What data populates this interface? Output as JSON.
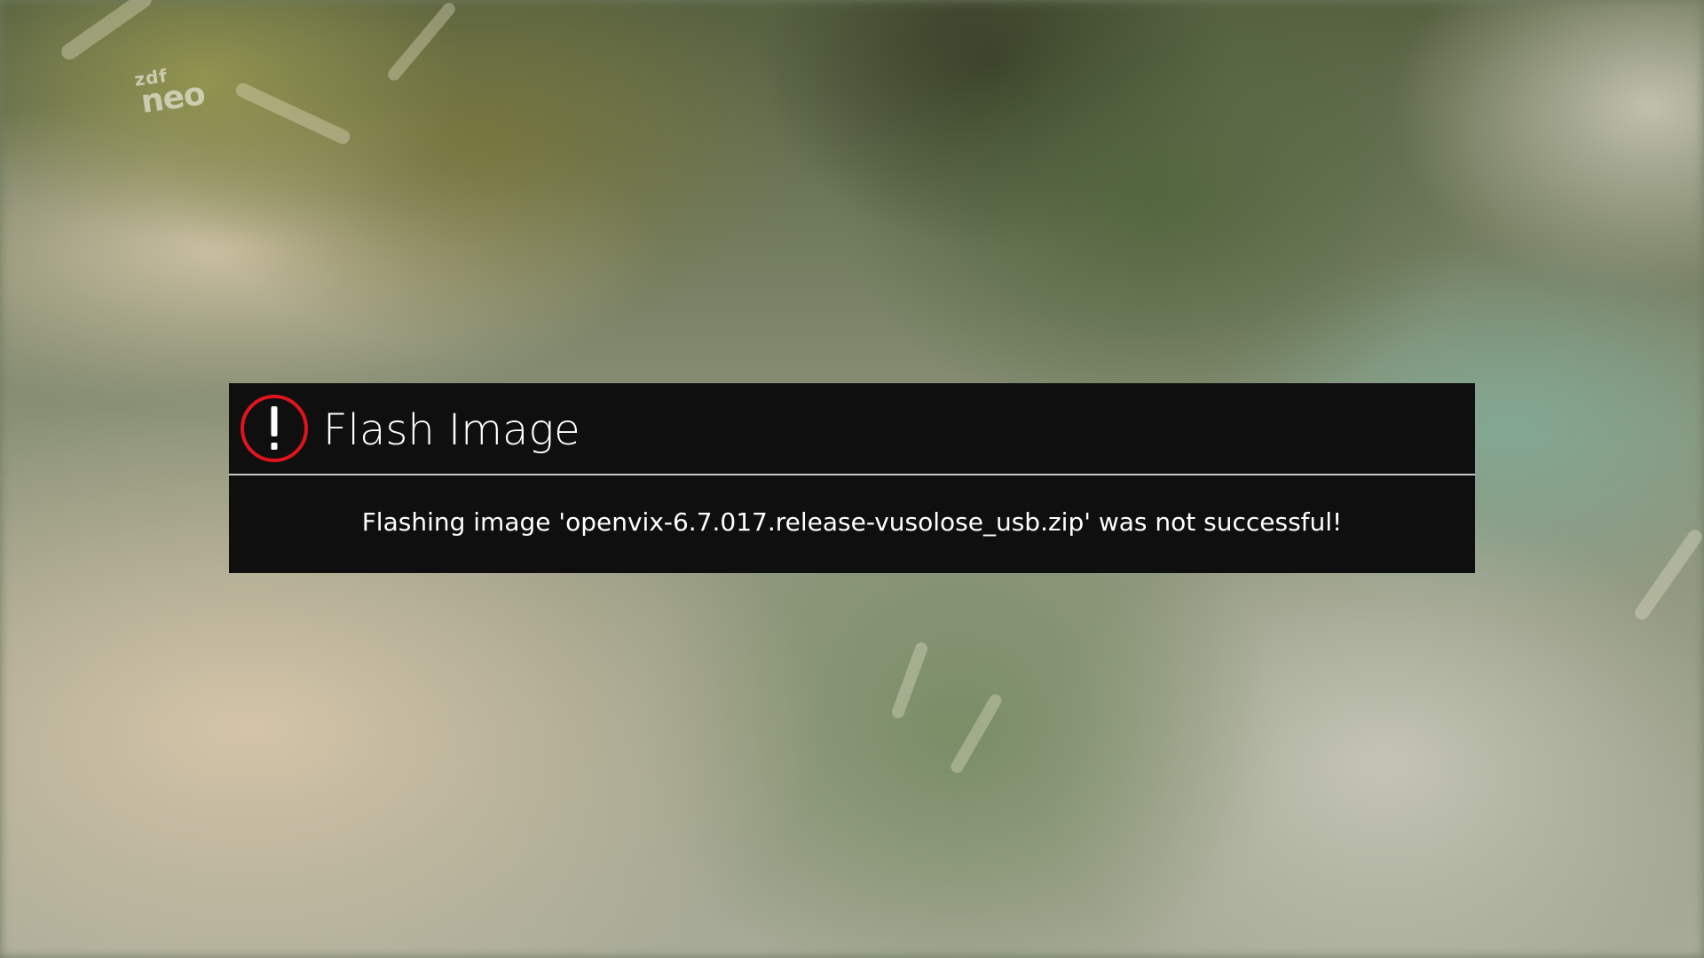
{
  "background": {
    "channel_logo_line1": "zdf",
    "channel_logo_line2": "neo"
  },
  "dialog": {
    "icon": "warning-exclamation-icon",
    "icon_color": "#e0141e",
    "title": "Flash Image",
    "message": "Flashing image 'openvix-6.7.017.release-vusolose_usb.zip' was not successful!",
    "background_color": "#0f0f0f"
  }
}
